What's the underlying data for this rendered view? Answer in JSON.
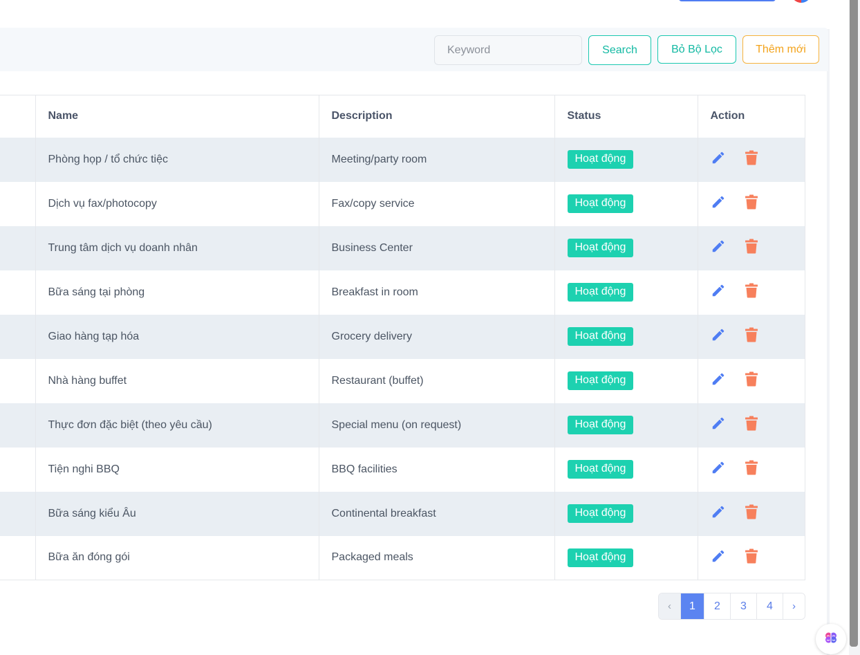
{
  "filter": {
    "keyword_placeholder": "Keyword",
    "keyword_value": "",
    "search_label": "Search",
    "clear_label": "Bỏ Bộ Lọc",
    "add_label": "Thêm mới"
  },
  "table": {
    "headers": {
      "name": "Name",
      "description": "Description",
      "status": "Status",
      "action": "Action"
    },
    "rows": [
      {
        "name": "Phòng họp / tổ chức tiệc",
        "description": "Meeting/party room",
        "status": "Hoạt động"
      },
      {
        "name": "Dịch vụ fax/photocopy",
        "description": "Fax/copy service",
        "status": "Hoạt động"
      },
      {
        "name": "Trung tâm dịch vụ doanh nhân",
        "description": "Business Center",
        "status": "Hoạt động"
      },
      {
        "name": "Bữa sáng tại phòng",
        "description": "Breakfast in room",
        "status": "Hoạt động"
      },
      {
        "name": "Giao hàng tạp hóa",
        "description": "Grocery delivery",
        "status": "Hoạt động"
      },
      {
        "name": "Nhà hàng buffet",
        "description": "Restaurant (buffet)",
        "status": "Hoạt động"
      },
      {
        "name": "Thực đơn đặc biệt (theo yêu cầu)",
        "description": "Special menu (on request)",
        "status": "Hoạt động"
      },
      {
        "name": "Tiện nghi BBQ",
        "description": "BBQ facilities",
        "status": "Hoạt động"
      },
      {
        "name": "Bữa sáng kiểu Âu",
        "description": "Continental breakfast",
        "status": "Hoạt động"
      },
      {
        "name": "Bữa ăn đóng gói",
        "description": "Packaged meals",
        "status": "Hoạt động"
      }
    ]
  },
  "pagination": {
    "prev": "‹",
    "pages": [
      "1",
      "2",
      "3",
      "4"
    ],
    "current": "1",
    "next": "›"
  },
  "icons": {
    "edit": "pencil-icon",
    "delete": "trash-icon",
    "widget": "brain-icon"
  },
  "colors": {
    "accent_teal": "#1dd1b0",
    "edit_blue": "#4f7df3",
    "delete_orange": "#f7805c",
    "add_orange": "#f6b23c",
    "page_active": "#5b84f1"
  }
}
